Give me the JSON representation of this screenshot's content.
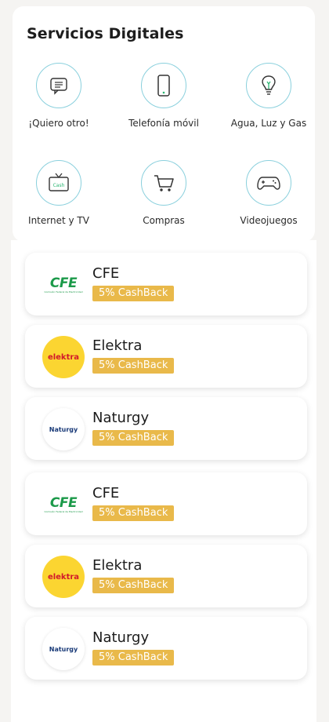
{
  "section": {
    "title": "Servicios Digitales"
  },
  "services": [
    {
      "label": "¡Quiero otro!",
      "icon": "chat-icon"
    },
    {
      "label": "Telefonía móvil",
      "icon": "phone-icon"
    },
    {
      "label": "Agua, Luz y Gas",
      "icon": "lightbulb-icon"
    },
    {
      "label": "Internet y TV",
      "icon": "tv-icon",
      "icon_text": "Cash"
    },
    {
      "label": "Compras",
      "icon": "cart-icon"
    },
    {
      "label": "Videojuegos",
      "icon": "gamepad-icon"
    }
  ],
  "providers": [
    {
      "name": "CFE",
      "cashback": "5% CashBack",
      "logo_text": "CFE",
      "logo_subtext": "Comisión Federal de Electricidad"
    },
    {
      "name": "Elektra",
      "cashback": "5% CashBack",
      "logo_text": "elektra"
    },
    {
      "name": "Naturgy",
      "cashback": "5% CashBack",
      "logo_text": "Naturgy"
    },
    {
      "name": "CFE",
      "cashback": "5% CashBack",
      "logo_text": "CFE",
      "logo_subtext": "Comisión Federal de Electricidad"
    },
    {
      "name": "Elektra",
      "cashback": "5% CashBack",
      "logo_text": "elektra"
    },
    {
      "name": "Naturgy",
      "cashback": "5% CashBack",
      "logo_text": "Naturgy"
    }
  ],
  "colors": {
    "icon_ring": "#8ad0dd",
    "cashback_badge": "#e9b94a",
    "elektra_yellow": "#fbd531",
    "cfe_green": "#1c9a4a"
  }
}
